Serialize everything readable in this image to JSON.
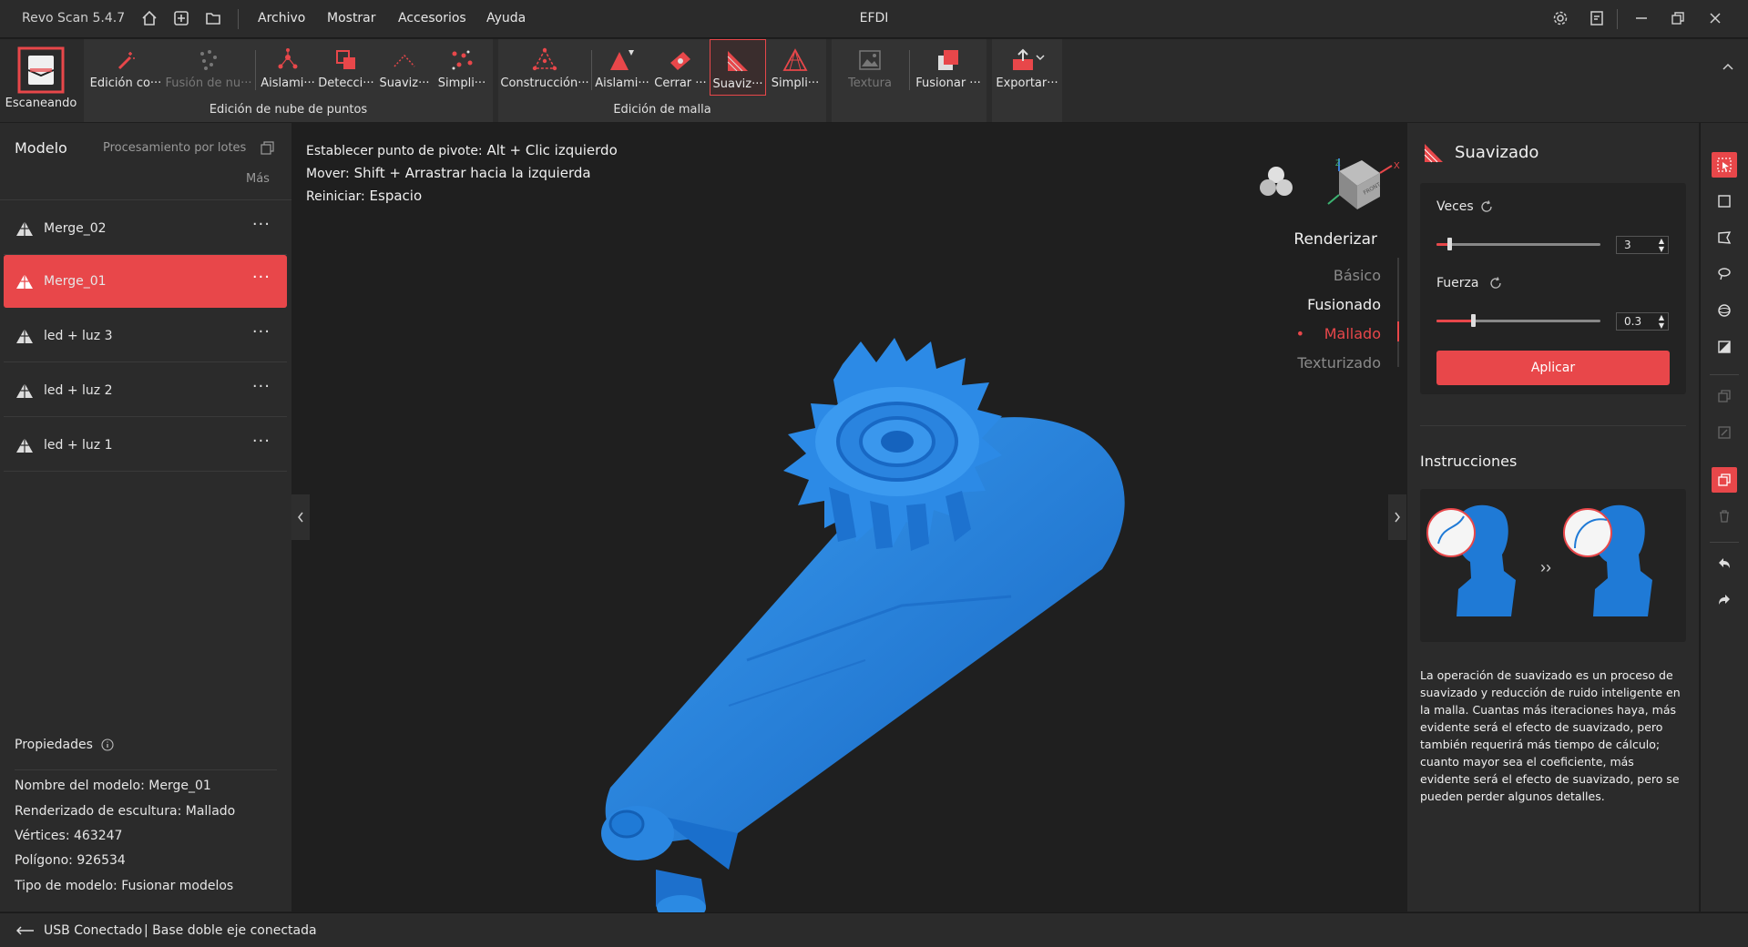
{
  "app": {
    "name": "Revo Scan 5.4.7",
    "window_title": "EFDI"
  },
  "menu": {
    "items": [
      "Archivo",
      "Mostrar",
      "Accesorios",
      "Ayuda"
    ]
  },
  "toolbar": {
    "scan_label": "Escaneando",
    "tools": {
      "edit_cloud": "Edición co···",
      "fuse_cloud": "Fusión de nu···",
      "isolate": "Aislami···",
      "detect": "Detecci···",
      "smooth_cloud": "Suaviz···",
      "simplify_cloud": "Simpli···",
      "construct": "Construcción···",
      "isolate_mesh": "Aislami···",
      "close": "Cerrar ···",
      "smooth_mesh": "Suaviz···",
      "simplify_mesh": "Simpli···",
      "texture": "Textura",
      "merge": "Fusionar ···",
      "export": "Exportar···"
    },
    "group_cloud": "Edición de nube de puntos",
    "group_mesh": "Edición de malla"
  },
  "left": {
    "model_title": "Modelo",
    "batch": "Procesamiento por lotes",
    "more": "Más",
    "models": [
      "Merge_02",
      "Merge_01",
      "led + luz 3",
      "led + luz 2",
      "led + luz 1"
    ],
    "selected_index": 1,
    "props_title": "Propiedades",
    "props": [
      {
        "label": "Nombre del modelo:",
        "value": "Merge_01"
      },
      {
        "label": "Renderizado de escultura:",
        "value": "Mallado"
      },
      {
        "label": "Vértices:",
        "value": "463247"
      },
      {
        "label": "Polígono:",
        "value": "926534"
      },
      {
        "label": "Tipo de modelo:",
        "value": "Fusionar modelos"
      }
    ]
  },
  "viewport": {
    "hints": [
      {
        "label": "Establecer punto de pivote:",
        "keys": "Alt + Clic izquierdo"
      },
      {
        "label": "Mover:",
        "keys": "Shift + Arrastrar hacia la izquierda"
      },
      {
        "label": "Reiniciar:",
        "keys": "Espacio"
      }
    ],
    "render_title": "Renderizar",
    "render_options": [
      "Básico",
      "Fusionado",
      "Mallado",
      "Texturizado"
    ],
    "render_selected": "Mallado",
    "gizmo_label": "FRONT"
  },
  "right": {
    "title": "Suavizado",
    "times_label": "Veces",
    "times_value": "3",
    "times_fraction": 0.08,
    "strength_label": "Fuerza",
    "strength_value": "0.3",
    "strength_fraction": 0.22,
    "apply": "Aplicar",
    "instructions_title": "Instrucciones",
    "description": "La operación de suavizado es un proceso de suavizado y reducción de ruido inteligente en la malla. Cuantas más iteraciones haya, más evidente será el efecto de suavizado, pero también requerirá más tiempo de cálculo; cuanto mayor sea el coeficiente, más evidente será el efecto de suavizado, pero se pueden perder algunos detalles."
  },
  "status": {
    "usb": "USB Conectado",
    "base": "| Base doble eje conectada"
  },
  "colors": {
    "accent": "#e8474a",
    "model_blue": "#1f7ad6"
  }
}
